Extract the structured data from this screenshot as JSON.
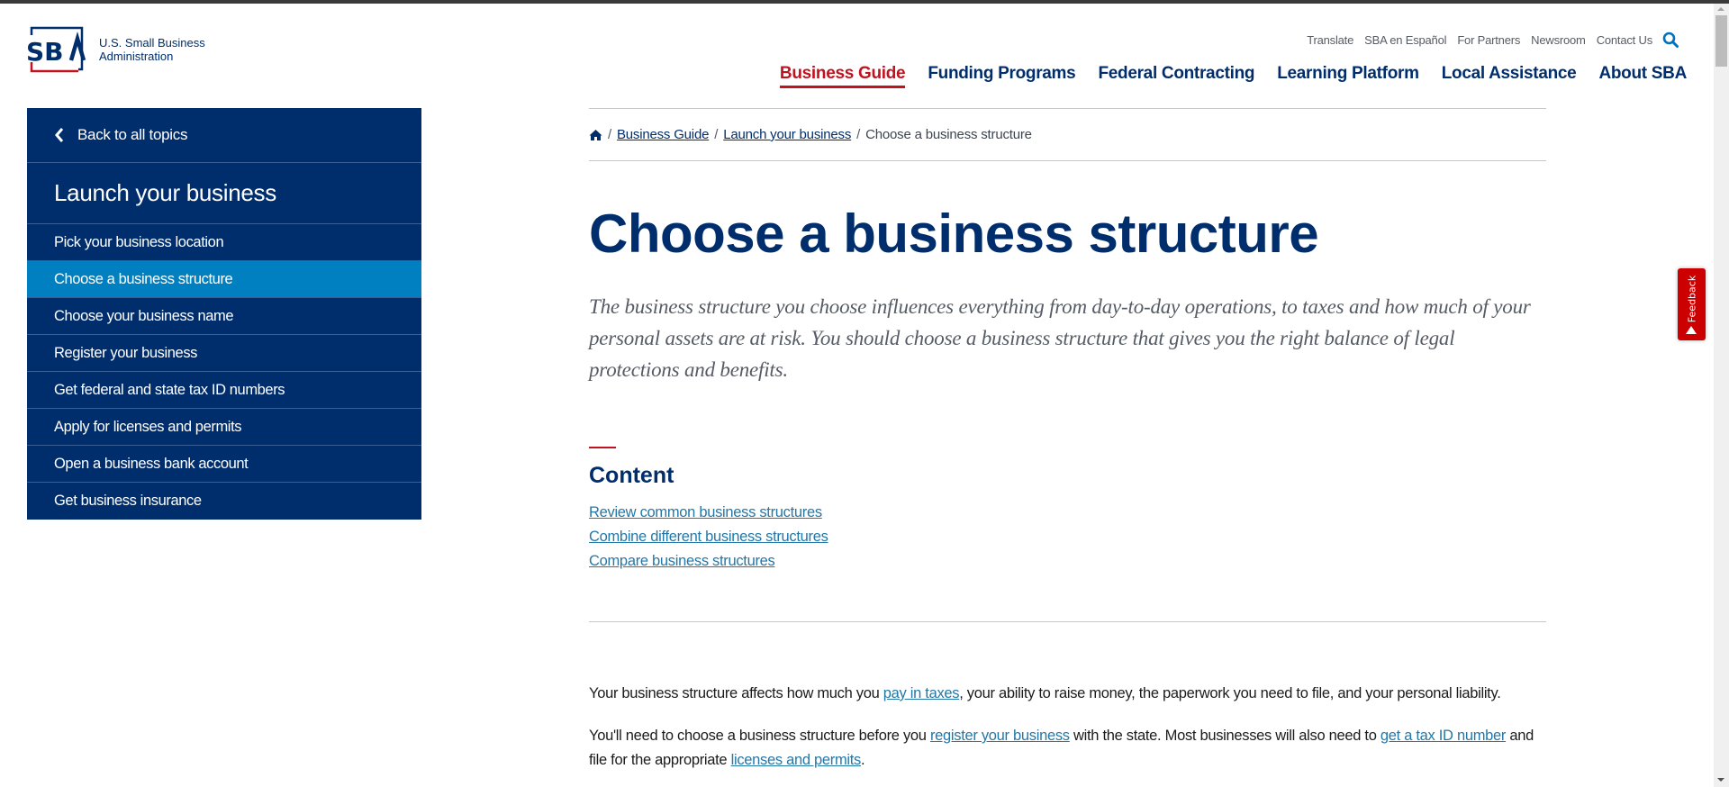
{
  "header": {
    "logo_text_line1": "U.S. Small Business",
    "logo_text_line2": "Administration",
    "utility_nav": [
      "Translate",
      "SBA en Español",
      "For Partners",
      "Newsroom",
      "Contact Us"
    ],
    "main_nav": [
      {
        "label": "Business Guide",
        "active": true
      },
      {
        "label": "Funding Programs",
        "active": false
      },
      {
        "label": "Federal Contracting",
        "active": false
      },
      {
        "label": "Learning Platform",
        "active": false
      },
      {
        "label": "Local Assistance",
        "active": false
      },
      {
        "label": "About SBA",
        "active": false
      }
    ]
  },
  "sidebar": {
    "back_label": "Back to all topics",
    "title": "Launch your business",
    "items": [
      {
        "label": "Pick your business location",
        "active": false
      },
      {
        "label": "Choose a business structure",
        "active": true
      },
      {
        "label": "Choose your business name",
        "active": false
      },
      {
        "label": "Register your business",
        "active": false
      },
      {
        "label": "Get federal and state tax ID numbers",
        "active": false
      },
      {
        "label": "Apply for licenses and permits",
        "active": false
      },
      {
        "label": "Open a business bank account",
        "active": false
      },
      {
        "label": "Get business insurance",
        "active": false
      }
    ]
  },
  "breadcrumb": {
    "home_icon": "home-icon",
    "items": [
      "Business Guide",
      "Launch your business"
    ],
    "current": "Choose a business structure",
    "separator": "/"
  },
  "main": {
    "title": "Choose a business structure",
    "lede": "The business structure you choose influences everything from day-to-day operations, to taxes and how much of your personal assets are at risk. You should choose a business structure that gives you the right balance of legal protections and benefits.",
    "content_heading": "Content",
    "toc": [
      "Review common business structures",
      "Combine different business structures",
      "Compare business structures"
    ],
    "p1": {
      "before": "Your business structure affects how much you ",
      "link": "pay in taxes",
      "after": ", your ability to raise money, the paperwork you need to file, and your personal liability."
    },
    "p2": {
      "part1": "You'll need to choose a business structure before you ",
      "link1": "register your business",
      "part2": " with the state. Most businesses will also need to ",
      "link2": "get a tax ID number",
      "part3": " and file for the appropriate ",
      "link3": "licenses and permits",
      "part4": "."
    }
  },
  "feedback": {
    "label": "Feedback"
  },
  "colors": {
    "brand_navy": "#002e6d",
    "brand_red": "#c1121f",
    "active_blue": "#0080c0",
    "link_blue": "#2378a8",
    "feedback_red": "#cc0000"
  }
}
